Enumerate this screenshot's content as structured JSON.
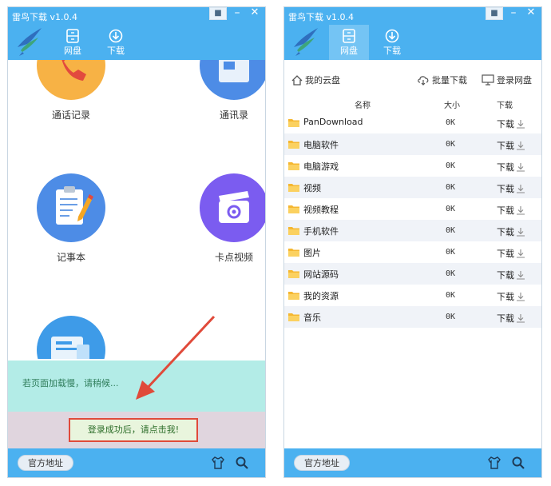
{
  "app": {
    "title": "雷鸟下载 v1.0.4"
  },
  "nav": {
    "pan": "网盘",
    "download": "下载"
  },
  "left": {
    "apps": [
      {
        "label": "通话记录"
      },
      {
        "label": "通讯录"
      },
      {
        "label": "记事本"
      },
      {
        "label": "卡点视频"
      }
    ],
    "loading_text": "若页面加载慢，请稍候...",
    "login_button": "登录成功后，请点击我!"
  },
  "right": {
    "toolbar": {
      "my_cloud": "我的云盘",
      "batch_download": "批量下载",
      "login_pan": "登录网盘"
    },
    "columns": {
      "name": "名称",
      "size": "大小",
      "download": "下载"
    },
    "files": [
      {
        "name": "PanDownload",
        "size": "0K",
        "action": "下载"
      },
      {
        "name": "电脑软件",
        "size": "0K",
        "action": "下载"
      },
      {
        "name": "电脑游戏",
        "size": "0K",
        "action": "下载"
      },
      {
        "name": "视频",
        "size": "0K",
        "action": "下载"
      },
      {
        "name": "视频教程",
        "size": "0K",
        "action": "下载"
      },
      {
        "name": "手机软件",
        "size": "0K",
        "action": "下载"
      },
      {
        "name": "图片",
        "size": "0K",
        "action": "下载"
      },
      {
        "name": "网站源码",
        "size": "0K",
        "action": "下载"
      },
      {
        "name": "我的资源",
        "size": "0K",
        "action": "下载"
      },
      {
        "name": "音乐",
        "size": "0K",
        "action": "下载"
      }
    ]
  },
  "footer": {
    "official_site": "官方地址"
  },
  "colors": {
    "header": "#4bb1f0",
    "accent_red": "#e04a3a",
    "loading_bg": "#b3ece7"
  }
}
